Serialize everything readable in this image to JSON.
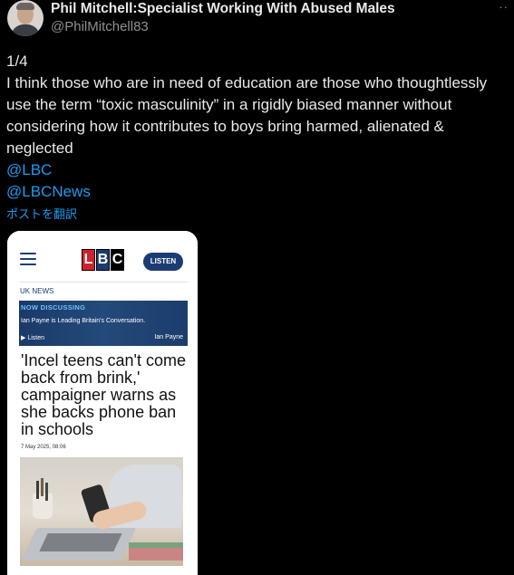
{
  "author": {
    "name": "Phil Mitchell:Specialist Working With Abused Males",
    "handle": "@PhilMitchell83",
    "more_icon": "more-icon"
  },
  "tweet": {
    "thread_index": "1/4",
    "text": "I think those who are in need of education are those who thoughtlessly use the term “toxic masculinity” in a rigidly biased manner without considering how it contributes to boys bring harmed, alienated & neglected",
    "mentions": [
      "@LBC",
      "@LBCNews"
    ],
    "translate_label": "ポストを翻訳",
    "mention_color": "#1d9bf0"
  },
  "embedded": {
    "logo_letters": [
      "L",
      "B",
      "C"
    ],
    "listen_button": "LISTEN",
    "section": "UK NEWS",
    "now_discussing_label": "NOW DISCUSSING",
    "now_discussing_text": "Ian Payne is Leading Britain's Conversation.",
    "listen_link": "▶ Listen",
    "host": "Ian Payne",
    "headline": "'Incel teens can't come back from brink,' campaigner warns as she backs phone ban in schools",
    "date": "7 May 2025, 08:06"
  }
}
